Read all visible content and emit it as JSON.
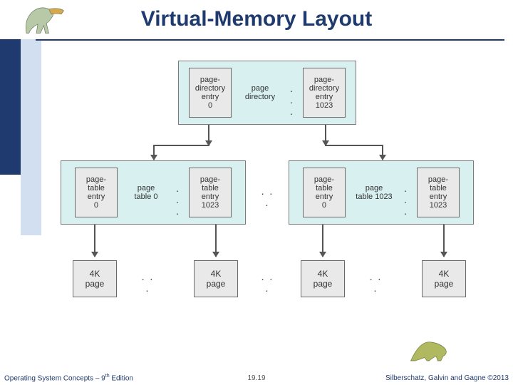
{
  "title": "Virtual-Memory Layout",
  "directory": {
    "entry0": "page-\ndirectory\nentry\n0",
    "label": "page\ndirectory",
    "entry1": "page-\ndirectory\nentry\n1023"
  },
  "table0": {
    "entry0": "page-\ntable\nentry\n0",
    "label": "page\ntable 0",
    "entry1": "page-\ntable\nentry\n1023"
  },
  "table1": {
    "entry0": "page-\ntable\nentry\n0",
    "label": "page\ntable 1023",
    "entry1": "page-\ntable\nentry\n1023"
  },
  "dots": ". . .",
  "page_label": "4K\npage",
  "footer": {
    "left_pre": "Operating System Concepts – 9",
    "left_sup": "th",
    "left_post": " Edition",
    "center": "19.19",
    "right": "Silberschatz, Galvin and Gagne ©2013"
  },
  "colors": {
    "accent": "#1f3a6e",
    "group_bg": "#d8f0f0",
    "box_bg": "#e9e9e9"
  }
}
